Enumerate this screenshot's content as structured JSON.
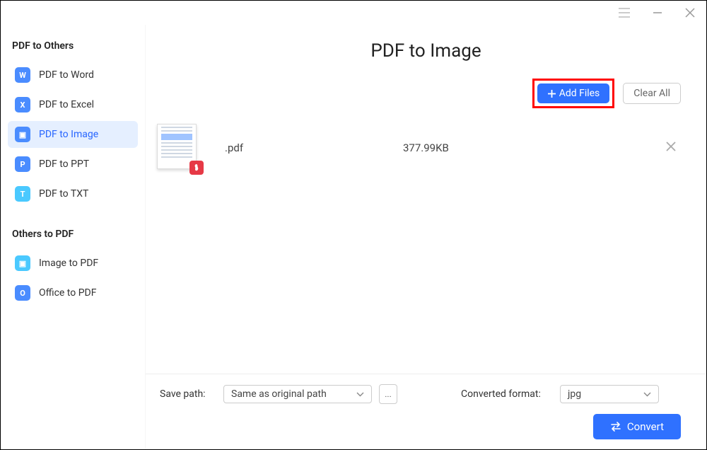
{
  "title": "PDF to Image",
  "sidebar": {
    "section1": "PDF to Others",
    "section2": "Others to PDF",
    "items1": [
      {
        "label": "PDF to Word",
        "icon": "W",
        "color": "#4a8cff"
      },
      {
        "label": "PDF to Excel",
        "icon": "X",
        "color": "#4a8cff"
      },
      {
        "label": "PDF to Image",
        "icon": "▣",
        "color": "#4a8cff",
        "active": true
      },
      {
        "label": "PDF to PPT",
        "icon": "P",
        "color": "#4a8cff"
      },
      {
        "label": "PDF to TXT",
        "icon": "T",
        "color": "#4ac9ff"
      }
    ],
    "items2": [
      {
        "label": "Image to PDF",
        "icon": "▣",
        "color": "#4ac9ff"
      },
      {
        "label": "Office to PDF",
        "icon": "O",
        "color": "#4a8cff"
      }
    ]
  },
  "toolbar": {
    "add_files": "Add Files",
    "clear_all": "Clear All"
  },
  "file": {
    "name": ".pdf",
    "size": "377.99KB"
  },
  "options": {
    "save_path_label": "Save path:",
    "save_path_value": "Same as original path",
    "browse": "...",
    "format_label": "Converted format:",
    "format_value": "jpg"
  },
  "convert_label": "Convert"
}
